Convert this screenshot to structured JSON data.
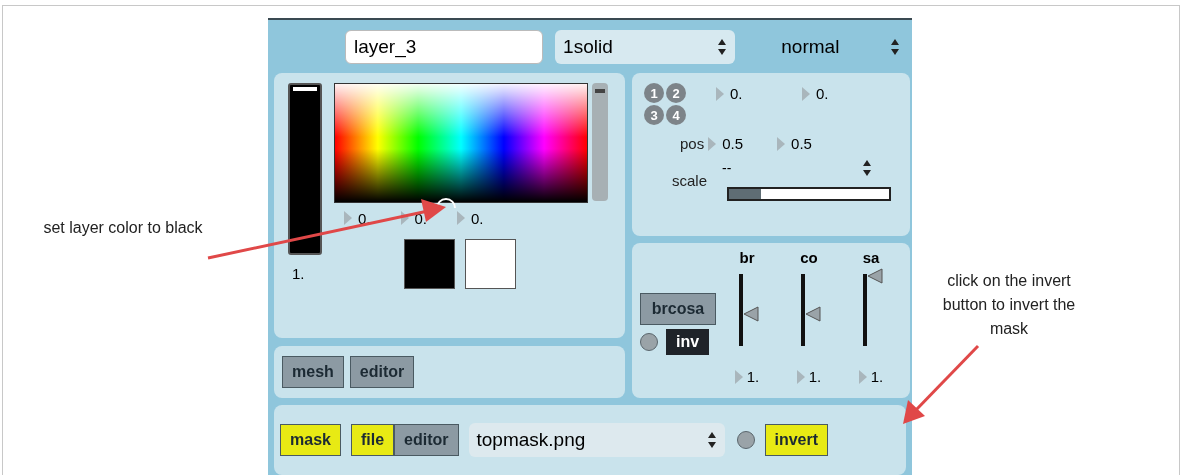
{
  "layer": {
    "name": "layer_3",
    "source": "1solid",
    "blend": "normal"
  },
  "color": {
    "brightness": {
      "level": 1,
      "reading": "1."
    },
    "values": [
      "0.",
      "0.",
      "0."
    ],
    "swatches": [
      {
        "color": "#000000"
      },
      {
        "color": "#ffffff"
      }
    ]
  },
  "mesh_buttons": [
    {
      "label": "mesh",
      "on": false
    },
    {
      "label": "editor",
      "on": false
    }
  ],
  "transform": {
    "badges": [
      "1",
      "2",
      "3",
      "4"
    ],
    "row1": [
      "0.",
      "0."
    ],
    "pos": {
      "label": "pos",
      "values": [
        "0.5",
        "0.5"
      ]
    },
    "scale": {
      "label": "scale",
      "value": "--",
      "level": 0.2
    }
  },
  "adjust": {
    "button": {
      "label": "brcosa",
      "on": false
    },
    "toggle": {
      "checked": false
    },
    "inv": {
      "label": "inv",
      "on": true
    },
    "sliders": [
      {
        "label": "br",
        "level": 0.45,
        "reading": "1."
      },
      {
        "label": "co",
        "level": 0.45,
        "reading": "1."
      },
      {
        "label": "sa",
        "level": 0.97,
        "reading": "1."
      }
    ]
  },
  "mask": {
    "buttons": [
      {
        "label": "mask",
        "on": true
      },
      {
        "label": "file",
        "on": true
      },
      {
        "label": "editor",
        "on": false
      }
    ],
    "file": "topmask.png",
    "toggle": {
      "checked": false
    },
    "invert": {
      "label": "invert",
      "on": true
    }
  },
  "annotations": [
    {
      "text": "set layer color to black"
    },
    {
      "text": "click on the invert button to invert the mask"
    }
  ]
}
